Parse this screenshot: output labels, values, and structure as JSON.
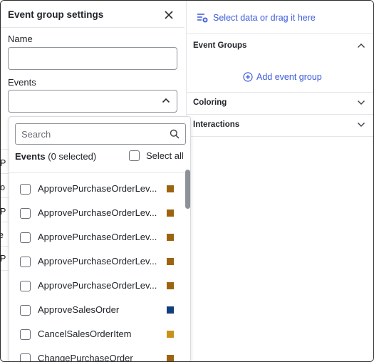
{
  "panel": {
    "title": "Event group settings",
    "name_label": "Name",
    "name_value": "",
    "events_label": "Events",
    "events_value": ""
  },
  "popup": {
    "search_placeholder": "Search",
    "events_heading": "Events",
    "selected_count": "(0 selected)",
    "select_all_label": "Select all",
    "items": [
      {
        "label": "ApprovePurchaseOrderLev...",
        "color": "#9c6410"
      },
      {
        "label": "ApprovePurchaseOrderLev...",
        "color": "#9c6410"
      },
      {
        "label": "ApprovePurchaseOrderLev...",
        "color": "#9c6410"
      },
      {
        "label": "ApprovePurchaseOrderLev...",
        "color": "#9c6410"
      },
      {
        "label": "ApprovePurchaseOrderLev...",
        "color": "#9c6410"
      },
      {
        "label": "ApproveSalesOrder",
        "color": "#123f7a"
      },
      {
        "label": "CancelSalesOrderItem",
        "color": "#c8921a"
      },
      {
        "label": "ChangePurchaseOrder",
        "color": "#9c6410"
      }
    ]
  },
  "right": {
    "select_data_label": "Select data or drag it here",
    "event_groups_label": "Event Groups",
    "add_event_group_label": "Add event group",
    "coloring_label": "Coloring",
    "interactions_label": "Interactions"
  },
  "background_rows": [
    "P",
    "ro",
    "P",
    "e",
    "P"
  ],
  "colors": {
    "accent": "#3b5bdb"
  }
}
